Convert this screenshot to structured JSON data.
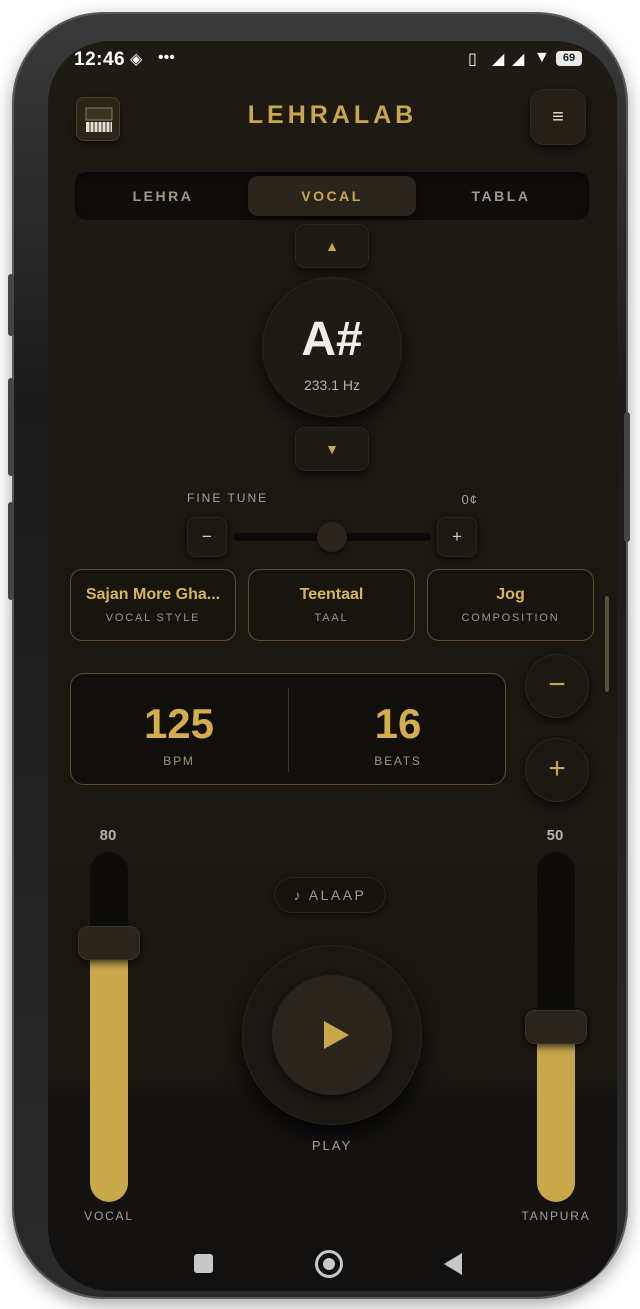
{
  "status_bar": {
    "time": "12:46",
    "battery": "69"
  },
  "header": {
    "title": "LEHRALAB",
    "menu_icon": "≡"
  },
  "tabs": [
    {
      "label": "LEHRA",
      "active": false
    },
    {
      "label": "VOCAL",
      "active": true
    },
    {
      "label": "TABLA",
      "active": false
    }
  ],
  "pitch": {
    "up_icon": "▲",
    "down_icon": "▼",
    "note": "A#",
    "frequency": "233.1 Hz"
  },
  "fine_tune": {
    "label": "FINE TUNE",
    "value": "0¢",
    "minus": "−",
    "plus": "+",
    "level": 0.5
  },
  "cards": [
    {
      "title": "Sajan More Gha...",
      "subtitle": "VOCAL STYLE"
    },
    {
      "title": "Teentaal",
      "subtitle": "TAAL"
    },
    {
      "title": "Jog",
      "subtitle": "COMPOSITION"
    }
  ],
  "tempo": {
    "bpm": "125",
    "bpm_label": "BPM",
    "beats": "16",
    "beats_label": "BEATS",
    "minus": "−",
    "plus": "+"
  },
  "mixer": {
    "vocal": {
      "value": "80",
      "label": "VOCAL",
      "level": 0.8
    },
    "tanpura": {
      "value": "50",
      "label": "TANPURA",
      "level": 0.5
    }
  },
  "alaap": {
    "label": "♪ ALAAP"
  },
  "play": {
    "label": "PLAY"
  },
  "colors": {
    "accent": "#c9a84c",
    "background": "#1c1912",
    "card_border": "#5c4e2c"
  }
}
